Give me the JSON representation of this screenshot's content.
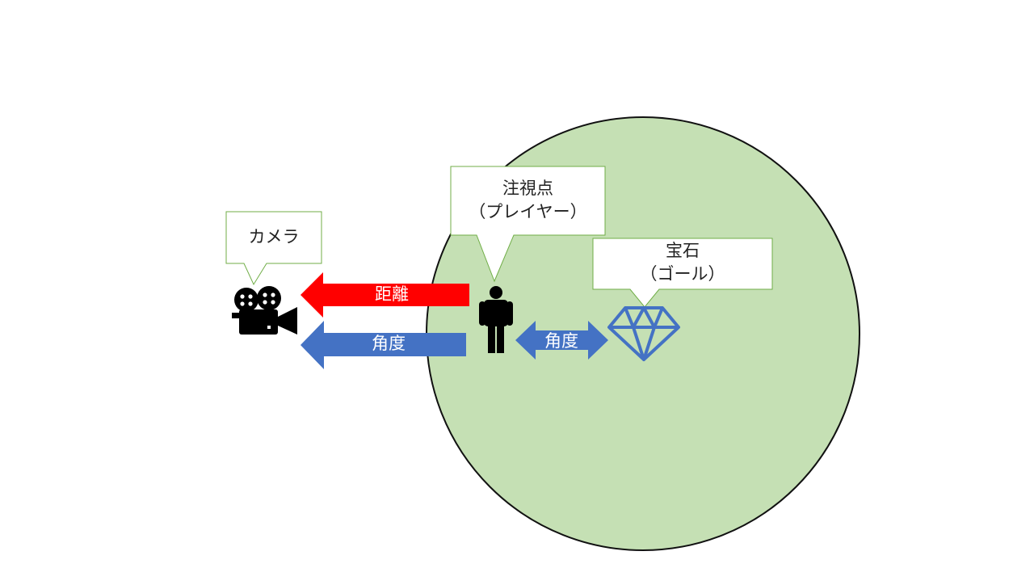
{
  "colors": {
    "circle_fill": "#c5e0b4",
    "circle_stroke": "#111111",
    "callout_border": "#70ad47",
    "red_arrow": "#ff0000",
    "blue_arrow": "#4472c4",
    "gem": "#4472c4",
    "icon": "#000000"
  },
  "icons": {
    "camera": "movie-camera-icon",
    "player": "person-icon",
    "goal": "diamond-icon"
  },
  "callouts": {
    "camera": {
      "text": "カメラ"
    },
    "player": {
      "line1": "注視点",
      "line2": "（プレイヤー）"
    },
    "goal": {
      "line1": "宝石",
      "line2": "（ゴール）"
    }
  },
  "arrows": {
    "distance": {
      "label": "距離"
    },
    "camera_angle": {
      "label": "角度"
    },
    "goal_angle": {
      "label": "角度"
    }
  }
}
